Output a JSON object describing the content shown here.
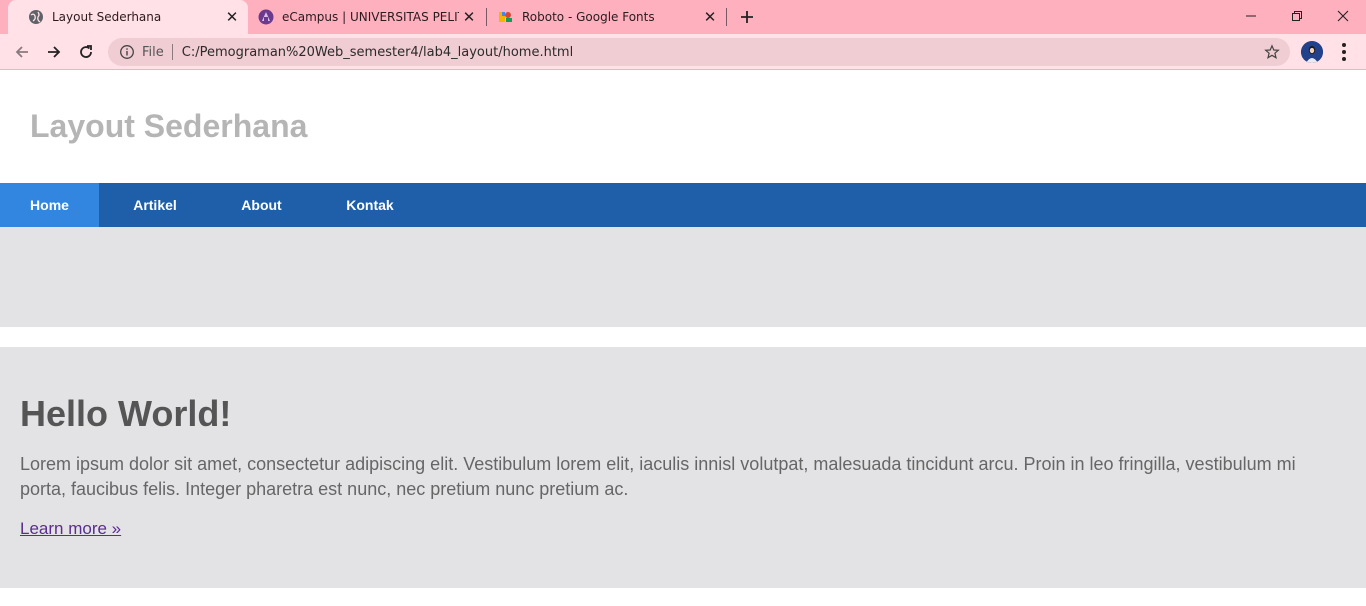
{
  "browser": {
    "tabs": [
      {
        "title": "Layout Sederhana",
        "favicon": "globe-icon",
        "active": true
      },
      {
        "title": "eCampus | UNIVERSITAS PELITA B",
        "favicon": "ecampus-icon",
        "active": false
      },
      {
        "title": "Roboto - Google Fonts",
        "favicon": "google-fonts-icon",
        "active": false
      }
    ],
    "address_bar": {
      "scheme_label": "File",
      "url": "C:/Pemograman%20Web_semester4/lab4_layout/home.html"
    },
    "colors": {
      "tabstrip": "#ffb0bf",
      "toolbar": "#ffe1e7",
      "omnibox": "#f0ccd3"
    }
  },
  "site": {
    "title": "Layout Sederhana",
    "nav": [
      {
        "label": "Home",
        "active": true
      },
      {
        "label": "Artikel",
        "active": false
      },
      {
        "label": "About",
        "active": false
      },
      {
        "label": "Kontak",
        "active": false
      }
    ],
    "hero": {
      "heading": "Hello World!",
      "text": "Lorem ipsum dolor sit amet, consectetur adipiscing elit. Vestibulum lorem elit, iaculis innisl volutpat, malesuada tincidunt arcu. Proin in leo fringilla, vestibulum mi porta, faucibus felis. Integer pharetra est nunc, nec pretium nunc pretium ac.",
      "link": "Learn more »"
    },
    "colors": {
      "nav_bg": "#1f5fa9",
      "nav_active": "#3286e0",
      "panel_bg": "#e3e3e5",
      "title": "#b5b5b5"
    }
  }
}
